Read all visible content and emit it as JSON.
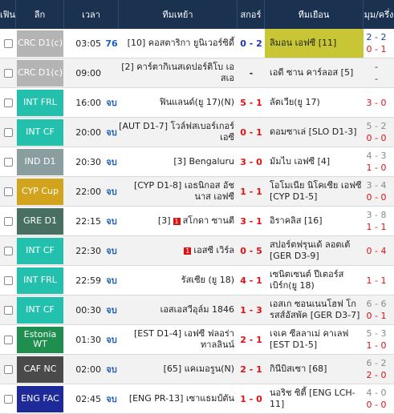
{
  "header": {
    "fav": "เฟิน",
    "league": "ลีก",
    "time": "เวลา",
    "home": "ทีมเหย้า",
    "score": "สกอร์",
    "away": "ทีมเยือน",
    "corner": "มุม/ครึ่ง"
  },
  "colors": {
    "header_bg": "#1a3150",
    "crc": "#b4b4b4",
    "int": "#22c0ad",
    "ind": "#8a9ea0",
    "cyp": "#d2a31c",
    "gre": "#476f62",
    "estonia": "#1f8f4f",
    "caf": "#4a4a4a",
    "eng": "#1e2a9a"
  },
  "rows": [
    {
      "league": "CRC D1(c)",
      "time": "03:05",
      "status": "76",
      "home": "[10] คอสตาริกา ยูนิเวอร์ซิดี้",
      "score": "0 - 2",
      "away": "ลิมอน เอฟซี [11]",
      "corner_top": "2 - 2",
      "corner_bottom": "0 - 1"
    },
    {
      "league": "CRC D1(c)",
      "time": "09:00",
      "status": "",
      "home": "[2] คาร์ตากิเนสเดปอร์ติโบ เอสเอ",
      "score": "-",
      "away": "เอดี ซาน คาร์ลอส [5]",
      "corner_top": "-",
      "corner_bottom": "-"
    },
    {
      "league": "INT FRL",
      "time": "16:00",
      "status": "จบ",
      "home": "ฟินแลนด์(ยู 17)(N)",
      "score": "5 - 1",
      "away": "ลัตเวีย(ยู 17)",
      "corner_top": "",
      "corner_bottom": "3 - 0"
    },
    {
      "league": "INT CF",
      "time": "20:00",
      "status": "จบ",
      "home": "[AUT D1-7] โวล์ฟสเบอร์เกอร์ เอซี",
      "score": "0 - 1",
      "away": "ดอมซาเล่ [SLO D1-3]",
      "corner_top": "5 - 2",
      "corner_bottom": "0 - 0"
    },
    {
      "league": "IND D1",
      "time": "20:30",
      "status": "จบ",
      "home": "[3] Bengaluru",
      "score": "3 - 0",
      "away": "มัมไบ เอฟซี [4]",
      "corner_top": "4 - 3",
      "corner_bottom": "1 - 0"
    },
    {
      "league": "CYP Cup",
      "time": "22:00",
      "status": "จบ",
      "home": "[CYP D1-8] เอธนิกอส อัชนาส เอฟซี",
      "score": "1 - 1",
      "away": "โอโมเนีย นิโคเซีย เอฟซี [CYP D1-5]",
      "corner_top": "3 - 4",
      "corner_bottom": "0 - 0"
    },
    {
      "league": "GRE D1",
      "time": "22:15",
      "status": "จบ",
      "home_prefix": "[3]",
      "home_card": "1",
      "home": "สโกดา ซานตี",
      "score": "3 - 1",
      "away": "อิราคลิส [16]",
      "corner_top": "3 - 8",
      "corner_bottom": "1 - 1"
    },
    {
      "league": "INT CF",
      "time": "22:30",
      "status": "จบ",
      "home_card": "1",
      "home": "เอสซี เวิร์ล",
      "score": "0 - 5",
      "away": "สปอร์ตฟรุนเด้ ลอตเต้ [GER D3-9]",
      "corner_top": "",
      "corner_bottom": "0 - 4"
    },
    {
      "league": "INT FRL",
      "time": "22:59",
      "status": "จบ",
      "home": "รัสเซีย (ยู 18)",
      "score": "4 - 1",
      "away": "เซนิตเซนต์ ปีเตอร์สเบิร์ก(ยู 18)",
      "corner_top": "",
      "corner_bottom": "1 - 1"
    },
    {
      "league": "INT CF",
      "time": "00:30",
      "status": "จบ",
      "home": "เอสเอสวีอุล์ม 1846",
      "score": "1 - 3",
      "away": "เอสเก ซอนเนนโฮฟ โกรสส์อัสพัค [GER D3-7]",
      "corner_top": "6 - 6",
      "corner_bottom": "0 - 1"
    },
    {
      "league": "Estonia WT",
      "time": "01:30",
      "status": "จบ",
      "home": "[EST D1-4] เอฟซี ฟลอร่า ทาลลินน์",
      "score": "2 - 1",
      "away": "เจเค ซีลลาเม่ คาเลฟ [EST D1-5]",
      "corner_top": "5 - 3",
      "corner_bottom": "1 - 0"
    },
    {
      "league": "CAF NC",
      "time": "02:00",
      "status": "จบ",
      "home": "[65] แคเมอรูน(N)",
      "score": "2 - 1",
      "away": "กินีบิสเซา [68]",
      "corner_top": "6 - 2",
      "corner_bottom": "2 - 0"
    },
    {
      "league": "ENG FAC",
      "time": "02:45",
      "status": "จบ",
      "home": "[ENG PR-13] เซาแธมป์ตัน",
      "score": "1 - 0",
      "away": "นอริช ซิตี้ [ENG LCH-11]",
      "corner_top": "4 - 0",
      "corner_bottom": "0 - 0"
    }
  ]
}
